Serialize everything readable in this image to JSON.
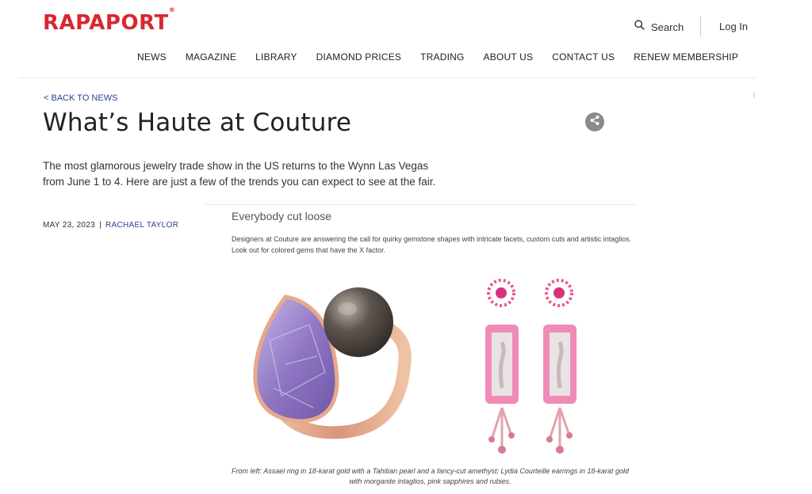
{
  "brand": {
    "name": "RAPAPORT",
    "mark": "®"
  },
  "header": {
    "search_label": "Search",
    "login_label": "Log In"
  },
  "nav": [
    "NEWS",
    "MAGAZINE",
    "LIBRARY",
    "DIAMOND PRICES",
    "TRADING",
    "ABOUT US",
    "CONTACT US",
    "RENEW MEMBERSHIP"
  ],
  "article": {
    "back_label": "< BACK TO NEWS",
    "title": "What’s Haute at Couture",
    "intro": "The most glamorous jewelry trade show in the US returns to the Wynn Las Vegas from June 1 to 4. Here are just a few of the trends you can expect to see at the fair.",
    "date": "MAY 23, 2023",
    "separator": "|",
    "author": "RACHAEL TAYLOR"
  },
  "feature": {
    "heading": "Everybody cut loose",
    "body": "Designers at Couture are answering the call for quirky gemstone shapes with intricate facets, custom cuts and artistic intaglios. Look out for colored gems that have the X factor.",
    "caption": "From left: Assael ring in 18-karat gold with a Tahitian pearl and a fancy-cut amethyst; Lydia Courteille earrings in 18-karat gold with morganite intaglios, pink sapphires and rubies."
  },
  "icons": {
    "search": "search-icon",
    "share": "share-icon"
  },
  "colors": {
    "brand_red": "#d9262f",
    "link_blue": "#2a3f8f",
    "amethyst": "#9b88c9",
    "rose_gold": "#e5a98a",
    "pink": "#e9559a"
  }
}
